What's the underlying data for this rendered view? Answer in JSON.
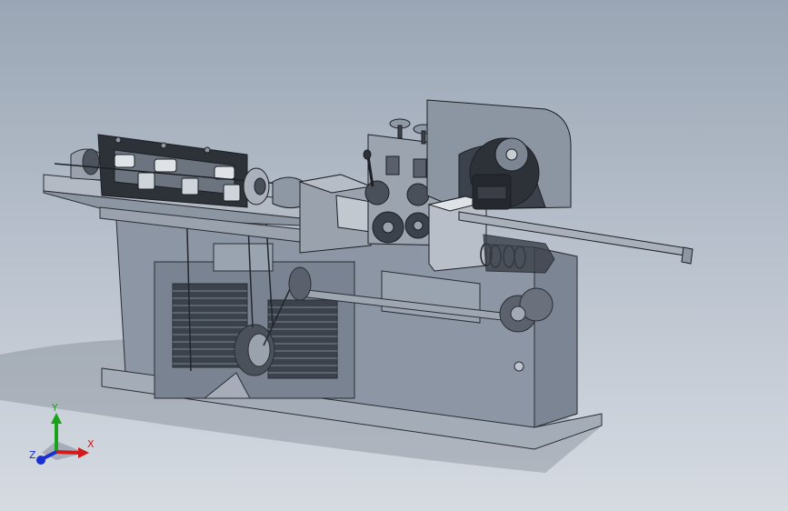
{
  "viewport": {
    "background_top": "#9aa6b5",
    "background_bottom": "#d6dbe2"
  },
  "model": {
    "edge_color": "#2a2d33",
    "body_fill": "#8f98a6",
    "dark_fill": "#2b2f36",
    "light_fill": "#c9ced6"
  },
  "triad": {
    "x_label": "X",
    "y_label": "Y",
    "z_label": "Z",
    "x_color": "#d11a1a",
    "y_color": "#1aa31a",
    "z_color": "#1a2fd1"
  }
}
